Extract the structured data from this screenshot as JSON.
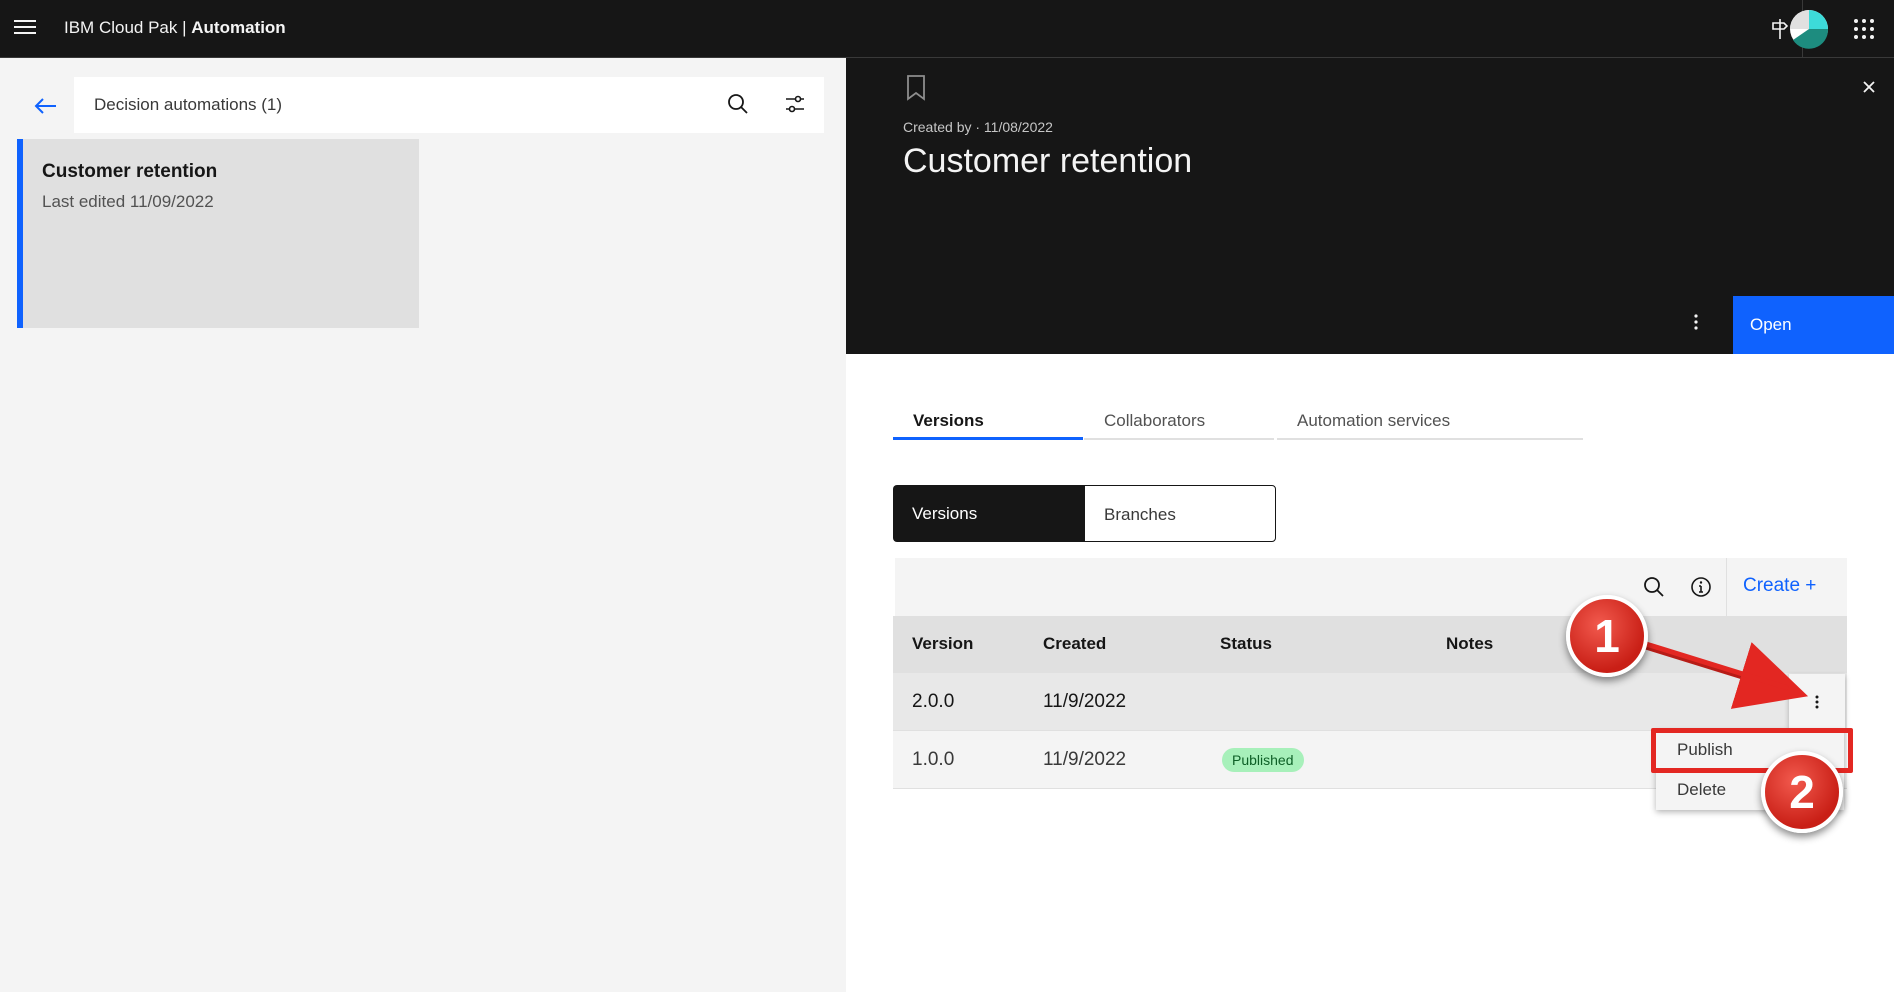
{
  "header": {
    "brand_prefix": "IBM Cloud Pak |",
    "brand_name": "Automation"
  },
  "sidebar": {
    "search_title": "Decision automations (1)",
    "card": {
      "title": "Customer retention",
      "subtitle": "Last edited 11/09/2022"
    }
  },
  "panel": {
    "created": "Created by · 11/08/2022",
    "title": "Customer retention",
    "open_label": "Open",
    "tabs": [
      {
        "label": "Versions",
        "active": true
      },
      {
        "label": "Collaborators",
        "active": false
      },
      {
        "label": "Automation services",
        "active": false
      }
    ],
    "segments": [
      "Versions",
      "Branches"
    ],
    "create_label": "Create  +",
    "table": {
      "headers": [
        "Version",
        "Created",
        "Status",
        "Notes"
      ],
      "rows": [
        {
          "version": "2.0.0",
          "created": "11/9/2022",
          "status": ""
        },
        {
          "version": "1.0.0",
          "created": "11/9/2022",
          "status": "Published"
        }
      ]
    },
    "row_menu": [
      "Publish",
      "Delete"
    ]
  },
  "annotations": {
    "step1": "1",
    "step2": "2",
    "color": "#e32722"
  }
}
